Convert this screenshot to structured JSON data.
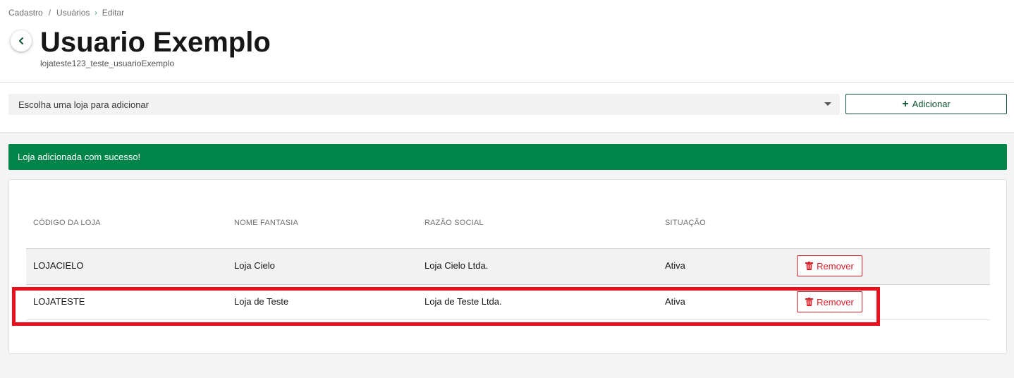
{
  "breadcrumb": {
    "items": [
      "Cadastro",
      "Usuários",
      "Editar"
    ],
    "separators": [
      "/",
      "›"
    ]
  },
  "header": {
    "title": "Usuario Exemplo",
    "subtitle": "lojateste123_teste_usuarioExemplo"
  },
  "toolbar": {
    "select_placeholder": "Escolha uma loja para adicionar",
    "add_label": "Adicionar"
  },
  "notification": {
    "message": "Loja adicionada com sucesso!",
    "color": "#00844a"
  },
  "table": {
    "columns": [
      "CÓDIGO DA LOJA",
      "NOME FANTASIA",
      "RAZÃO SOCIAL",
      "SITUAÇÃO"
    ],
    "rows": [
      {
        "code": "LOJACIELO",
        "name": "Loja Cielo",
        "company": "Loja Cielo Ltda.",
        "status": "Ativa",
        "action": "Remover"
      },
      {
        "code": "LOJATESTE",
        "name": "Loja de Teste",
        "company": "Loja de Teste Ltda.",
        "status": "Ativa",
        "action": "Remover"
      }
    ]
  },
  "icons": {
    "back": "chevron-left-icon",
    "dropdown": "caret-down-icon",
    "add": "plus-icon",
    "remove": "trash-icon"
  },
  "colors": {
    "accent": "#0e5233",
    "danger": "#da1e28",
    "highlight": "#e8101c"
  }
}
